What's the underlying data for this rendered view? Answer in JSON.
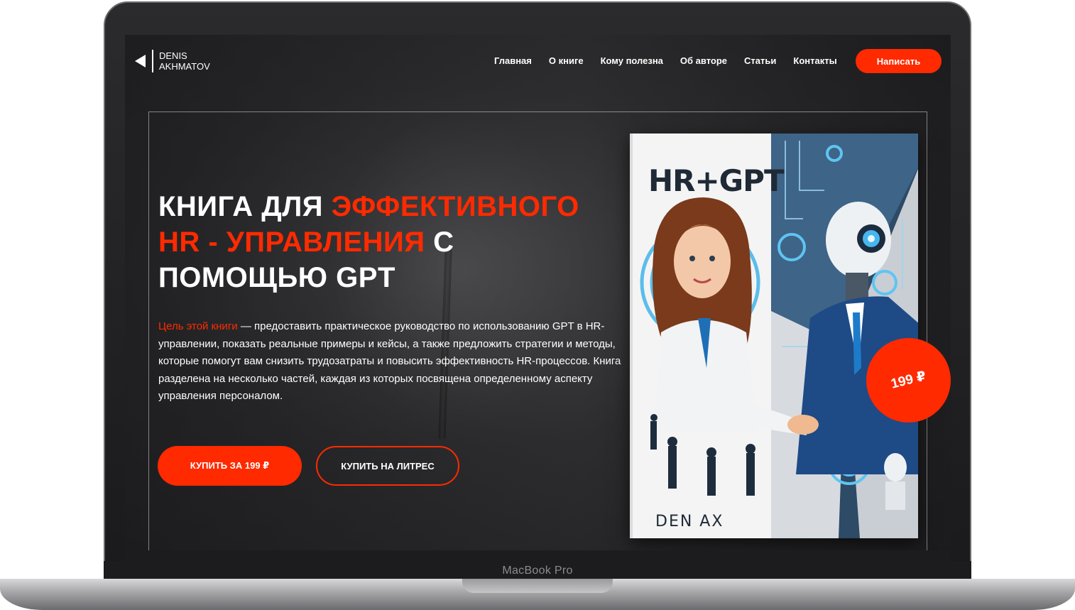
{
  "device": {
    "label": "MacBook Pro"
  },
  "logo": {
    "line1": "DENIS",
    "line2": "AKHMATOV"
  },
  "nav": {
    "items": [
      "Главная",
      "О книге",
      "Кому полезна",
      "Об авторе",
      "Статьи",
      "Контакты"
    ],
    "cta": "Написать"
  },
  "hero": {
    "title_part1": "КНИГА ДЛЯ ",
    "title_accent1": "ЭФФЕКТИВНОГО",
    "title_accent2": "HR - УПРАВЛЕНИЯ",
    "title_part2": " С",
    "title_part3": "ПОМОЩЬЮ GPT",
    "desc_lead": "Цель этой книги",
    "desc_body": " — предоставить практическое руководство по использованию GPT в HR-управлении, показать реальные примеры и кейсы, а также предложить стратегии и методы, которые помогут вам снизить трудозатраты и повысить эффективность HR-процессов. Книга разделена на несколько частей, каждая из которых посвящена определенному аспекту управления персоналом.",
    "buy_button": "КУПИТЬ ЗА 199 ₽",
    "litres_button": "КУПИТЬ НА ЛИТРЕС"
  },
  "book": {
    "title": "HR+GPT",
    "author": "DEN AX",
    "price": "199 ₽"
  },
  "colors": {
    "accent": "#ff2a00",
    "background": "#2e2e30",
    "text": "#ffffff"
  }
}
